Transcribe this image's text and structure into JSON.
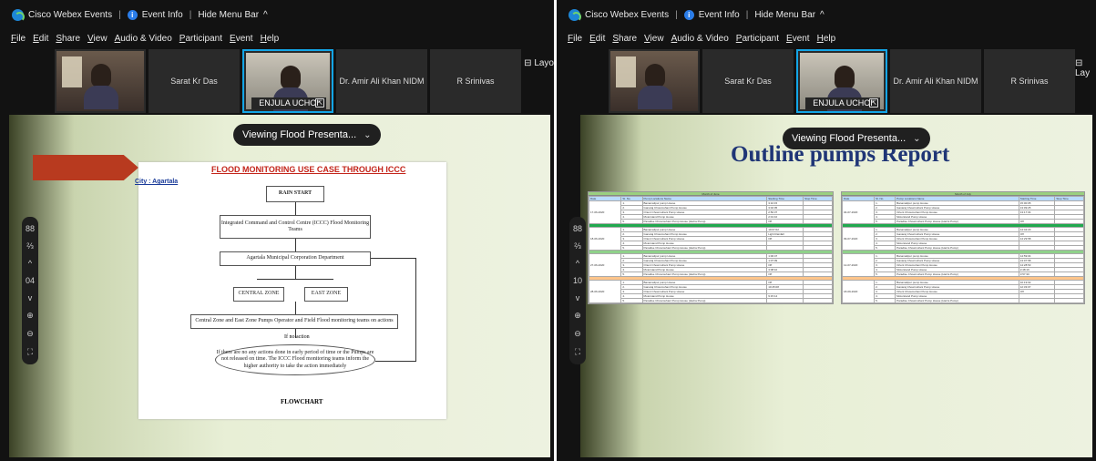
{
  "titlebar": {
    "app": "Cisco Webex Events",
    "event_info": "Event Info",
    "hide_menu": "Hide Menu Bar",
    "chevron": "^"
  },
  "menu": [
    "File",
    "Edit",
    "Share",
    "View",
    "Audio & Video",
    "Participant",
    "Event",
    "Help"
  ],
  "participants": {
    "p2": "Sarat Kr Das",
    "active": "ENJULA UCHOI",
    "p4": "Dr. Amir Ali Khan NIDM",
    "p5": "R Srinivas"
  },
  "layout_label": "Layo",
  "layout_label_right": "Lay",
  "viewing": "Viewing Flood Presenta...",
  "side_controls": {
    "left": [
      "88",
      "⅔",
      "^",
      "04",
      "v",
      "⊕",
      "⊖",
      "⛶"
    ],
    "right": [
      "88",
      "⅔",
      "^",
      "10",
      "v",
      "⊕",
      "⊖",
      "⛶"
    ]
  },
  "flow": {
    "title": "FLOOD MONITORING USE CASE THROUGH ICCC",
    "city": "City : Agartala",
    "rain": "RAIN START",
    "iccc": "Integrated Command and Control Centre (ICCC) Flood Monitoring Teams",
    "amc": "Agartala Municipal Corporation Department",
    "central": "CENTRAL ZONE",
    "east": "EAST ZONE",
    "ops": "Central Zone and East Zone Pumps Operator and Field Flood monitoring teams on actions",
    "ifno": "If no action",
    "escalate": "If there are no any actions done in early period of time or the Pumps are not released on time. The ICCC Flood monitoring teams inform the higher authority to take the action immediately",
    "footer": "FLOWCHART"
  },
  "report": {
    "title": "Outline pumps Report",
    "header": [
      "Date",
      "Sl. No.",
      "Pump Locations Name",
      "Starting Time",
      "Stop Time"
    ],
    "left_dates": [
      "17-06-2020",
      "18-06-2020",
      "27-06-2020",
      "28-06-2020"
    ],
    "right_dates": [
      "04-07-2020",
      "09-07-2020",
      "12-07-2020",
      "18-09-2020"
    ],
    "pumps": [
      "Banamalipur pump House",
      "Ganaraj Chowmuhani Pump House",
      "Orient Chowmuhani Pump House",
      "Motorstand Pump House",
      "Paradise Chowmuhani Pump House (Hazra Pump)"
    ],
    "times_left": [
      "3:10:15",
      "3:02:05",
      "2:50:37",
      "2:01:10",
      "Off",
      "10:07:02",
      "Light Rainfall",
      "Off",
      "1:00:47",
      "1:07:09",
      "Off",
      "3:08:10",
      "Off",
      "10:45:08",
      "9:15:14"
    ],
    "times_right": [
      "15:00:05",
      "13:09:25",
      "13:17:04",
      "14:42:23",
      "Off",
      "14:29:58",
      "14:59:04",
      "13:07:58",
      "14:28:53",
      "2:48:16",
      "3:57:30",
      "10:19:02",
      "12:33:07",
      "Off"
    ]
  }
}
